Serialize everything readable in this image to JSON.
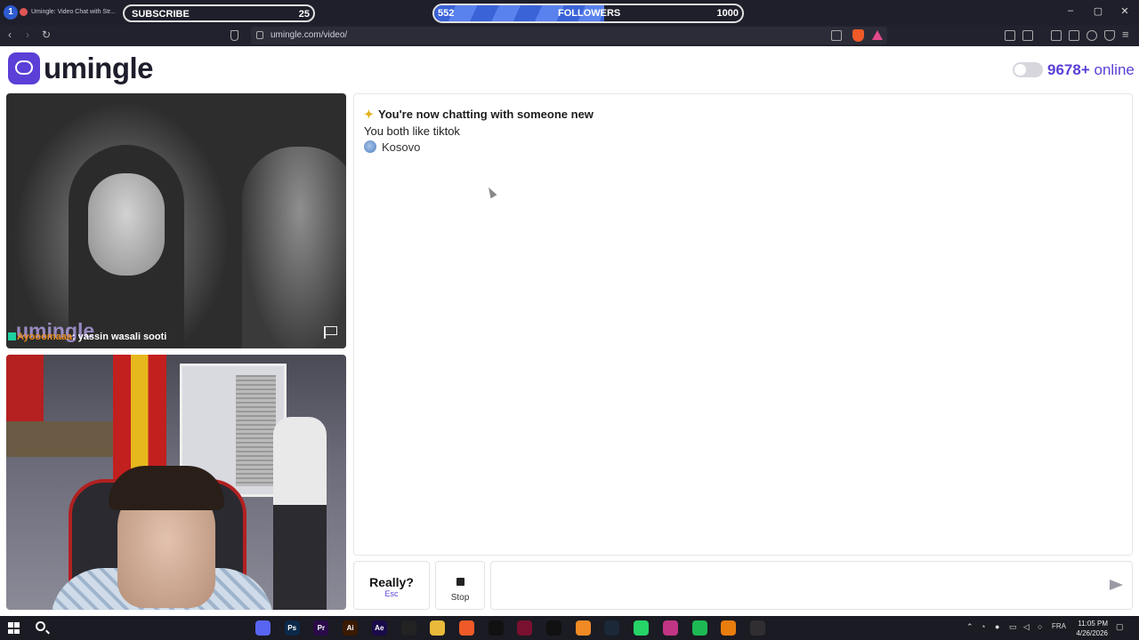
{
  "browser": {
    "tab_number": "1",
    "tab_title": "Umingle: Video Chat with Str...",
    "url": "umingle.com/video/",
    "window_controls": [
      "–",
      "▢",
      "✕"
    ]
  },
  "overlay": {
    "subscribe_label": "SUBSCRIBE",
    "subscribe_count": "25",
    "followers_current": "552",
    "followers_label": "FOLLOWERS",
    "followers_goal": "1000",
    "followers_progress": 0.552
  },
  "header": {
    "logo_text": "umingle",
    "online_count": "9678+",
    "online_label": "online"
  },
  "stranger_video": {
    "watermark": "umingle",
    "caption_name": "Ayooomaaa",
    "caption_text": ": yassin wasali sooti"
  },
  "chat": {
    "status_message": "You're now chatting with someone new",
    "common_interest": "You both like tiktok",
    "country": "Kosovo"
  },
  "controls": {
    "really_label": "Really?",
    "really_key": "Esc",
    "stop_label": "Stop",
    "input_placeholder": ""
  },
  "taskbar": {
    "time": "11:05 PM",
    "date": "4/26/2026",
    "lang": "FRA",
    "apps": [
      {
        "name": "discord-icon",
        "label": "",
        "color": "#5865f2"
      },
      {
        "name": "photoshop-icon",
        "label": "Ps",
        "color": "#0b2a4a"
      },
      {
        "name": "premiere-icon",
        "label": "Pr",
        "color": "#2a0a4a"
      },
      {
        "name": "illustrator-icon",
        "label": "Ai",
        "color": "#3a1a00"
      },
      {
        "name": "aftereffects-icon",
        "label": "Ae",
        "color": "#1a0a4a"
      },
      {
        "name": "capcut-icon",
        "label": "",
        "color": "#222"
      },
      {
        "name": "explorer-icon",
        "label": "",
        "color": "#e8b93a"
      },
      {
        "name": "brave-icon",
        "label": "",
        "color": "#ef5a28"
      },
      {
        "name": "tiktok-icon",
        "label": "",
        "color": "#111"
      },
      {
        "name": "vegas-icon",
        "label": "",
        "color": "#7a1030"
      },
      {
        "name": "netflix-icon",
        "label": "",
        "color": "#111"
      },
      {
        "name": "fl-studio-icon",
        "label": "",
        "color": "#f08a24"
      },
      {
        "name": "steam-icon",
        "label": "",
        "color": "#1b2838"
      },
      {
        "name": "whatsapp-icon",
        "label": "",
        "color": "#25d366"
      },
      {
        "name": "instagram-icon",
        "label": "",
        "color": "#c13584"
      },
      {
        "name": "spotify-icon",
        "label": "",
        "color": "#1db954"
      },
      {
        "name": "blender-icon",
        "label": "",
        "color": "#e87d0d"
      },
      {
        "name": "obs-icon",
        "label": "",
        "color": "#302e31"
      }
    ]
  }
}
